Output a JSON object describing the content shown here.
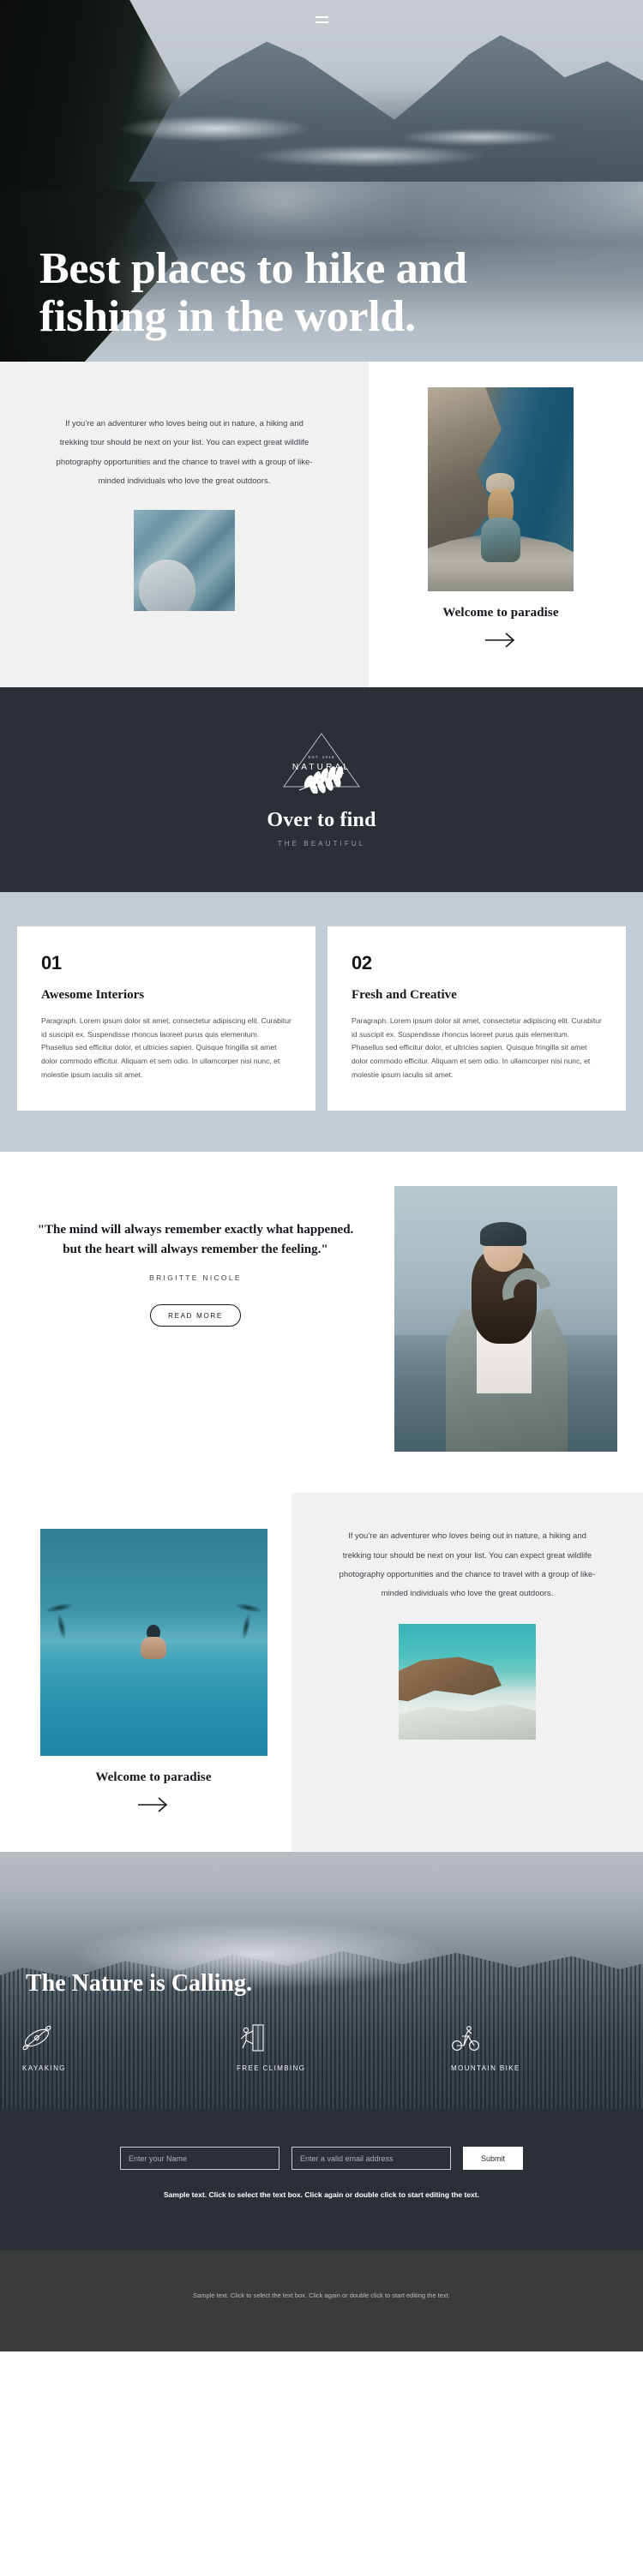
{
  "hero": {
    "menu_icon": "hamburger-menu-icon",
    "title": "Best places to hike and fishing in the world."
  },
  "intro": {
    "paragraph": "If you’re an adventurer who loves being out in nature, a hiking and trekking tour should be next on your list. You can expect great wildlife photography opportunities and the chance to travel with a group of like-minded individuals who love the great outdoors.",
    "caption": "Welcome to paradise",
    "arrow_icon": "arrow-right-icon"
  },
  "brand": {
    "logo_est": "EST. 2018",
    "logo_name": "NATURAL",
    "title": "Over to find",
    "subtitle": "THE BEAUTIFUL"
  },
  "cards": [
    {
      "number": "01",
      "title": "Awesome Interiors",
      "text": "Paragraph. Lorem ipsum dolor sit amet, consectetur adipiscing elit. Curabitur id suscipit ex. Suspendisse rhoncus laoreet purus quis elementum. Phasellus sed efficitur dolor, et ultricies sapien. Quisque fringilla sit amet dolor commodo efficitur. Aliquam et sem odio. In ullamcorper nisi nunc, et molestie ipsum iaculis sit amet."
    },
    {
      "number": "02",
      "title": "Fresh and Creative",
      "text": "Paragraph. Lorem ipsum dolor sit amet, consectetur adipiscing elit. Curabitur id suscipit ex. Suspendisse rhoncus laoreet purus quis elementum. Phasellus sed efficitur dolor, et ultricies sapien. Quisque fringilla sit amet dolor commodo efficitur. Aliquam et sem odio. In ullamcorper nisi nunc, et molestie ipsum iaculis sit amet."
    }
  ],
  "quote": {
    "text": "\"The mind will always remember exactly what happened. but the heart will always remember the feeling.\"",
    "author": "BRIGITTE NICOLE",
    "button": "READ MORE"
  },
  "paradise2": {
    "caption": "Welcome to paradise",
    "arrow_icon": "arrow-right-icon",
    "paragraph": "If you’re an adventurer who loves being out in nature, a hiking and trekking tour should be next on your list. You can expect great wildlife photography opportunities and the chance to travel with a group of like-minded individuals who love the great outdoors."
  },
  "nature": {
    "title": "The Nature is Calling.",
    "activities": [
      {
        "label": "KAYAKING",
        "icon": "kayak-icon"
      },
      {
        "label": "FREE CLIMBING",
        "icon": "climber-icon"
      },
      {
        "label": "MOUNTAIN BIKE",
        "icon": "bicycle-icon"
      }
    ]
  },
  "form": {
    "name_placeholder": "Enter your Name",
    "email_placeholder": "Enter a valid email address",
    "submit_label": "Submit",
    "note": "Sample text. Click to select the text box. Click again or double click to start editing the text."
  },
  "footer": {
    "note": "Sample text. Click to select the text box. Click again or double click to start editing the text."
  },
  "colors": {
    "dark": "#2b3036",
    "footer": "#3a3b3b",
    "cards_bg": "#c4ccd6",
    "light_panel": "#f1f1f1"
  }
}
